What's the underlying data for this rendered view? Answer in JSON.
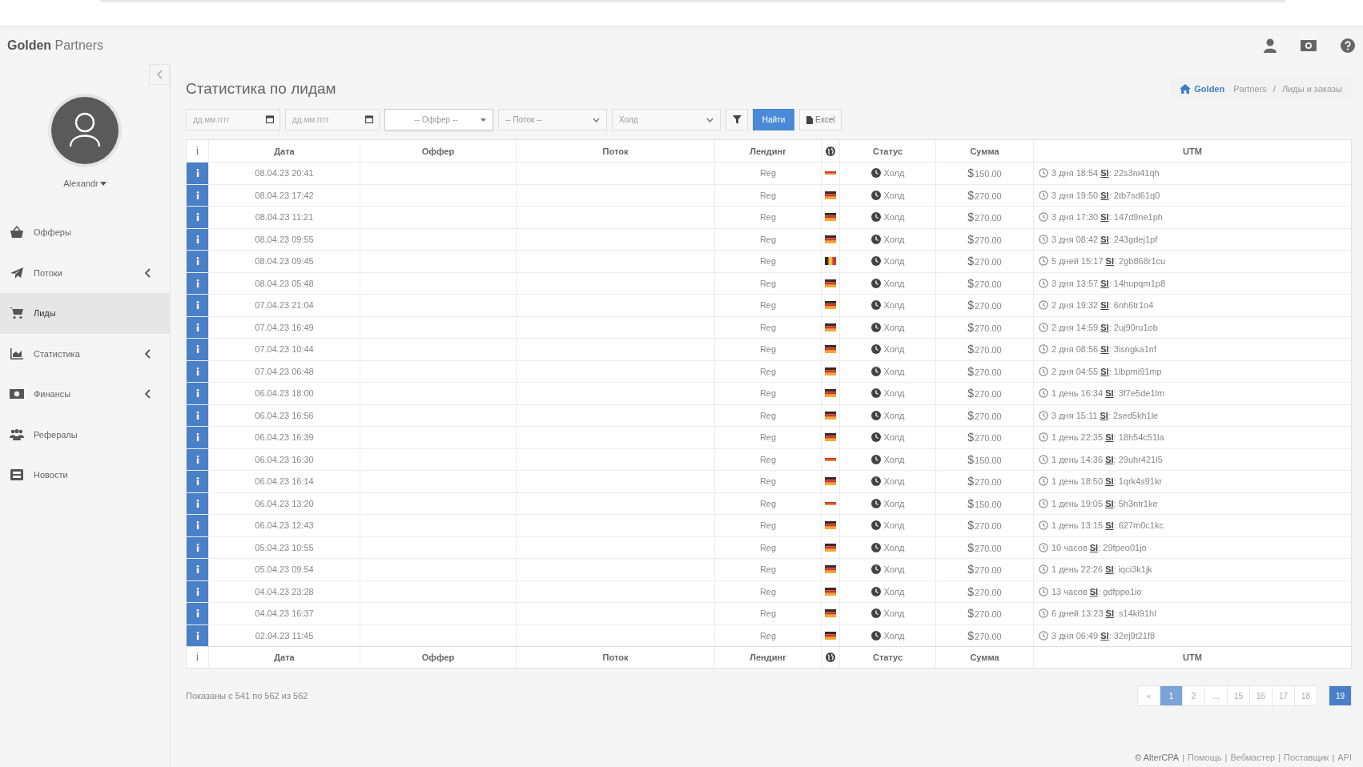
{
  "header": {
    "brand_bold": "Golden",
    "brand_light": "Partners"
  },
  "sidebar": {
    "user": "Alexandr",
    "items": [
      {
        "label": "Офферы",
        "selected": false,
        "expandable": false
      },
      {
        "label": "Потоки",
        "selected": false,
        "expandable": true
      },
      {
        "label": "Лиды",
        "selected": true,
        "expandable": false
      },
      {
        "label": "Статистика",
        "selected": false,
        "expandable": true
      },
      {
        "label": "Финансы",
        "selected": false,
        "expandable": true
      },
      {
        "label": "Рефералы",
        "selected": false,
        "expandable": false
      },
      {
        "label": "Новости",
        "selected": false,
        "expandable": false
      }
    ]
  },
  "page_title": "Статистика по лидам",
  "breadcrumb": {
    "home_bold": "Golden",
    "home_light": "Partners",
    "separator": "/",
    "current": "Лиды и заказы"
  },
  "filters": {
    "date_from": {
      "placeholder": "дд.мм.гггг"
    },
    "date_to": {
      "placeholder": "дд.мм.гггг"
    },
    "offer": "-- Оффер --",
    "flow": "-- Поток --",
    "status": "Холд",
    "find_button": "Найти",
    "excel_button": "Excel"
  },
  "table": {
    "info_header": "i",
    "columns": [
      "Дата",
      "Оффер",
      "Поток",
      "Лендинг",
      "Статус",
      "Сумма",
      "UTM"
    ],
    "rows": [
      {
        "date": "08.04.23 20:41",
        "landing": "Reg",
        "kind": "band-h",
        "status": "Холд",
        "currency": "$",
        "sum": "150.00",
        "utm": "3 дня 18:54 **SI**: 22s3ni41qh"
      },
      {
        "date": "08.04.23 17:42",
        "landing": "Reg",
        "kind": "tricolor-h",
        "status": "Холд",
        "currency": "$",
        "sum": "270.00",
        "utm": "3 дня 19:50 **SI**: 2tb7sd61q0"
      },
      {
        "date": "08.04.23 11:21",
        "landing": "Reg",
        "kind": "tricolor-h",
        "status": "Холд",
        "currency": "$",
        "sum": "270.00",
        "utm": "3 дня 17:30 **SI**: 147d9ne1ph"
      },
      {
        "date": "08.04.23 09:55",
        "landing": "Reg",
        "kind": "tricolor-h",
        "status": "Холд",
        "currency": "$",
        "sum": "270.00",
        "utm": "3 дня 08:42 **SI**: 243gdej1pf"
      },
      {
        "date": "08.04.23 09:45",
        "landing": "Reg",
        "kind": "tricolor-v",
        "status": "Холд",
        "currency": "$",
        "sum": "270.00",
        "utm": "5 дней 15:17 **SI**: 2gb868r1cu"
      },
      {
        "date": "08.04.23 05:48",
        "landing": "Reg",
        "kind": "tricolor-h",
        "status": "Холд",
        "currency": "$",
        "sum": "270.00",
        "utm": "3 дня 13:57 **SI**: 14hupqm1p8"
      },
      {
        "date": "07.04.23 21:04",
        "landing": "Reg",
        "kind": "tricolor-h",
        "status": "Холд",
        "currency": "$",
        "sum": "270.00",
        "utm": "2 дня 19:32 **SI**: 6nh6tr1o4"
      },
      {
        "date": "07.04.23 16:49",
        "landing": "Reg",
        "kind": "tricolor-h",
        "status": "Холд",
        "currency": "$",
        "sum": "270.00",
        "utm": "2 дня 14:59 **SI**: 2uj90ru1ob"
      },
      {
        "date": "07.04.23 10:44",
        "landing": "Reg",
        "kind": "tricolor-h",
        "status": "Холд",
        "currency": "$",
        "sum": "270.00",
        "utm": "2 дня 08:56 **SI**: 3isngka1nf"
      },
      {
        "date": "07.04.23 06:48",
        "landing": "Reg",
        "kind": "tricolor-h",
        "status": "Холд",
        "currency": "$",
        "sum": "270.00",
        "utm": "2 дня 04:55 **SI**: 1lbpmi91mp"
      },
      {
        "date": "06.04.23 18:00",
        "landing": "Reg",
        "kind": "tricolor-h",
        "status": "Холд",
        "currency": "$",
        "sum": "270.00",
        "utm": "1 день 16:34 **SI**: 3f7e5de1lm"
      },
      {
        "date": "06.04.23 16:56",
        "landing": "Reg",
        "kind": "tricolor-h",
        "status": "Холд",
        "currency": "$",
        "sum": "270.00",
        "utm": "3 дня 15:11 **SI**: 2sed5kh1le"
      },
      {
        "date": "06.04.23 16:39",
        "landing": "Reg",
        "kind": "tricolor-h",
        "status": "Холд",
        "currency": "$",
        "sum": "270.00",
        "utm": "1 день 22:35 **SI**: 18h54c51la"
      },
      {
        "date": "06.04.23 16:30",
        "landing": "Reg",
        "kind": "band-h",
        "status": "Холд",
        "currency": "$",
        "sum": "150.00",
        "utm": "1 день 14:36 **SI**: 29uhr421l5"
      },
      {
        "date": "06.04.23 16:14",
        "landing": "Reg",
        "kind": "tricolor-h",
        "status": "Холд",
        "currency": "$",
        "sum": "270.00",
        "utm": "1 день 18:50 **SI**: 1qrk4s91kr"
      },
      {
        "date": "06.04.23 13:20",
        "landing": "Reg",
        "kind": "band-h",
        "status": "Холд",
        "currency": "$",
        "sum": "150.00",
        "utm": "1 день 19:05 **SI**: 5h3ntr1ke"
      },
      {
        "date": "06.04.23 12:43",
        "landing": "Reg",
        "kind": "tricolor-h",
        "status": "Холд",
        "currency": "$",
        "sum": "270.00",
        "utm": "1 день 13:15 **SI**: 627m0c1kc"
      },
      {
        "date": "05.04.23 10:55",
        "landing": "Reg",
        "kind": "tricolor-h",
        "status": "Холд",
        "currency": "$",
        "sum": "270.00",
        "utm": "10 часов **SI**: 29fpeo01jo"
      },
      {
        "date": "05.04.23 09:54",
        "landing": "Reg",
        "kind": "tricolor-h",
        "status": "Холд",
        "currency": "$",
        "sum": "270.00",
        "utm": "1 день 22:26 **SI**: iqci3k1jk"
      },
      {
        "date": "04.04.23 23:28",
        "landing": "Reg",
        "kind": "tricolor-h",
        "status": "Холд",
        "currency": "$",
        "sum": "270.00",
        "utm": "13 часов **SI**: gdfppo1io"
      },
      {
        "date": "04.04.23 16:37",
        "landing": "Reg",
        "kind": "tricolor-h",
        "status": "Холд",
        "currency": "$",
        "sum": "270.00",
        "utm": "6 дней 13:23 **SI**: s14ki91hl"
      },
      {
        "date": "02.04.23 11:45",
        "landing": "Reg",
        "kind": "tricolor-h",
        "status": "Холд",
        "currency": "$",
        "sum": "270.00",
        "utm": "3 дня 06:49 **SI**: 32ej9t21f8"
      }
    ],
    "info_footer": "i",
    "footer_columns": [
      "Дата",
      "Оффер",
      "Поток",
      "Лендинг",
      "Статус",
      "Сумма",
      "UTM"
    ]
  },
  "summary": "Показаны с 541 по 562 из 562",
  "pagination": [
    {
      "label": "«",
      "selected": false,
      "hover": false
    },
    {
      "label": "1",
      "selected": false,
      "hover": true
    },
    {
      "label": "2",
      "selected": false,
      "hover": false
    },
    {
      "label": "...",
      "selected": false,
      "hover": false
    },
    {
      "label": "15",
      "selected": false,
      "hover": false
    },
    {
      "label": "16",
      "selected": false,
      "hover": false
    },
    {
      "label": "17",
      "selected": false,
      "hover": false
    },
    {
      "label": "18",
      "selected": false,
      "hover": false
    },
    {
      "label": "19",
      "selected": true,
      "hover": false
    }
  ],
  "footer": [
    {
      "label": "© AlterCPA",
      "kind": "copyright"
    },
    {
      "label": "Помощь",
      "kind": "link"
    },
    {
      "label": "Вебмастер",
      "kind": "link"
    },
    {
      "label": "Поставщик",
      "kind": "link"
    },
    {
      "label": "API",
      "kind": "link"
    }
  ],
  "footer_separator": "|"
}
